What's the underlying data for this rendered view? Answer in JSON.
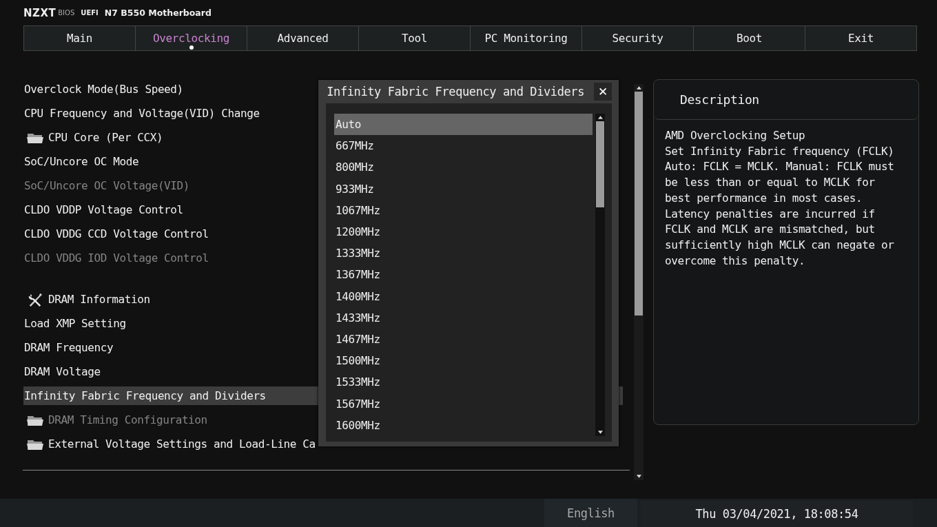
{
  "header": {
    "brand": "NZXT",
    "bios": "BIOS",
    "uefi": "UEFI",
    "model": "N7 B550 Motherboard"
  },
  "tabs": [
    {
      "label": "Main",
      "selected": false
    },
    {
      "label": "Overclocking",
      "selected": true
    },
    {
      "label": "Advanced",
      "selected": false
    },
    {
      "label": "Tool",
      "selected": false
    },
    {
      "label": "PC Monitoring",
      "selected": false
    },
    {
      "label": "Security",
      "selected": false
    },
    {
      "label": "Boot",
      "selected": false
    },
    {
      "label": "Exit",
      "selected": false
    }
  ],
  "menu": [
    {
      "kind": "item",
      "label": "Overclock Mode(Bus Speed)",
      "disabled": false,
      "selected": false
    },
    {
      "kind": "item",
      "label": "CPU Frequency and Voltage(VID) Change",
      "disabled": false,
      "selected": false
    },
    {
      "kind": "folder",
      "label": "CPU Core (Per CCX)",
      "disabled": false,
      "selected": false
    },
    {
      "kind": "item",
      "label": "SoC/Uncore OC Mode",
      "disabled": false,
      "selected": false
    },
    {
      "kind": "item",
      "label": "SoC/Uncore OC Voltage(VID)",
      "disabled": true,
      "selected": false
    },
    {
      "kind": "item",
      "label": "CLDO VDDP Voltage Control",
      "disabled": false,
      "selected": false
    },
    {
      "kind": "item",
      "label": "CLDO VDDG CCD Voltage Control",
      "disabled": false,
      "selected": false
    },
    {
      "kind": "item",
      "label": "CLDO VDDG IOD Voltage Control",
      "disabled": true,
      "selected": false
    },
    {
      "kind": "tools",
      "label": "DRAM Information",
      "disabled": false,
      "selected": false
    },
    {
      "kind": "item",
      "label": "Load XMP Setting",
      "disabled": false,
      "selected": false
    },
    {
      "kind": "item",
      "label": "DRAM Frequency",
      "disabled": false,
      "selected": false
    },
    {
      "kind": "item",
      "label": "DRAM Voltage",
      "disabled": false,
      "selected": false
    },
    {
      "kind": "item",
      "label": "Infinity Fabric Frequency and Dividers",
      "disabled": false,
      "selected": true
    },
    {
      "kind": "folder",
      "label": "DRAM Timing Configuration",
      "disabled": true,
      "selected": false
    },
    {
      "kind": "folder",
      "label": "External Voltage Settings and Load-Line Ca",
      "disabled": false,
      "selected": false
    }
  ],
  "dialog": {
    "title": "Infinity Fabric Frequency and Dividers",
    "close": "✕",
    "options": [
      {
        "label": "Auto",
        "selected": true
      },
      {
        "label": "667MHz",
        "selected": false
      },
      {
        "label": "800MHz",
        "selected": false
      },
      {
        "label": "933MHz",
        "selected": false
      },
      {
        "label": "1067MHz",
        "selected": false
      },
      {
        "label": "1200MHz",
        "selected": false
      },
      {
        "label": "1333MHz",
        "selected": false
      },
      {
        "label": "1367MHz",
        "selected": false
      },
      {
        "label": "1400MHz",
        "selected": false
      },
      {
        "label": "1433MHz",
        "selected": false
      },
      {
        "label": "1467MHz",
        "selected": false
      },
      {
        "label": "1500MHz",
        "selected": false
      },
      {
        "label": "1533MHz",
        "selected": false
      },
      {
        "label": "1567MHz",
        "selected": false
      },
      {
        "label": "1600MHz",
        "selected": false
      }
    ]
  },
  "description": {
    "title": "Description",
    "text": "AMD Overclocking Setup\nSet Infinity Fabric frequency (FCLK)\nAuto: FCLK = MCLK. Manual: FCLK must\nbe less than or equal to MCLK for\nbest performance in most cases.\nLatency penalties are incurred if\nFCLK and MCLK are mismatched, but\nsufficiently high MCLK can negate or\novercome this penalty."
  },
  "status_bar": {
    "language": "English",
    "datetime": "Thu 03/04/2021, 18:08:54"
  }
}
